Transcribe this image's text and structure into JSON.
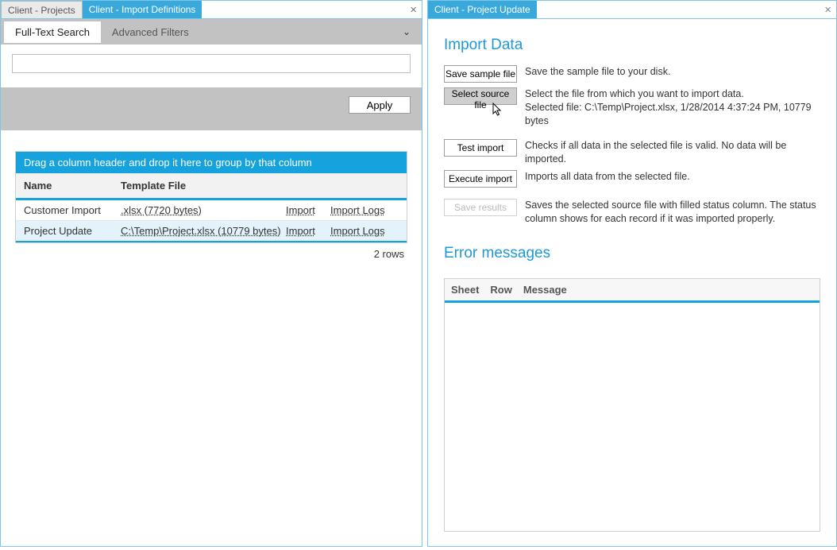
{
  "tabs_left": {
    "inactive": "Client - Projects",
    "active": "Client - Import Definitions"
  },
  "tabs_right": {
    "active": "Client - Project Update"
  },
  "filter": {
    "tab_fulltext": "Full-Text Search",
    "tab_advanced": "Advanced Filters",
    "apply": "Apply"
  },
  "grid": {
    "group_hint": "Drag a column header and drop it here to group by that column",
    "col_name": "Name",
    "col_tmpl": "Template File",
    "link_import": "Import",
    "link_logs": "Import Logs",
    "rows": [
      {
        "name": "Customer Import",
        "template": ".xlsx (7720 bytes)"
      },
      {
        "name": "Project Update",
        "template": "C:\\Temp\\Project.xlsx (10779 bytes)"
      }
    ],
    "footer": "2 rows"
  },
  "right": {
    "heading1": "Import Data",
    "btn_save_sample": "Save sample file",
    "desc_save_sample": "Save the sample file to your disk.",
    "btn_select": "Select source file",
    "desc_select_line1": "Select the file from which you want to import data.",
    "desc_select_line2": "Selected file: C:\\Temp\\Project.xlsx, 1/28/2014 4:37:24 PM, 10779 bytes",
    "btn_test": "Test import",
    "desc_test": "Checks if all data in the selected file is valid. No data will be imported.",
    "btn_exec": "Execute import",
    "desc_exec": "Imports all data from the selected file.",
    "btn_saveres": "Save results",
    "desc_saveres": "Saves the selected source file with filled status column. The status column shows for each record if it was imported properly.",
    "heading2": "Error messages",
    "err_cols": {
      "sheet": "Sheet",
      "row": "Row",
      "msg": "Message"
    }
  }
}
